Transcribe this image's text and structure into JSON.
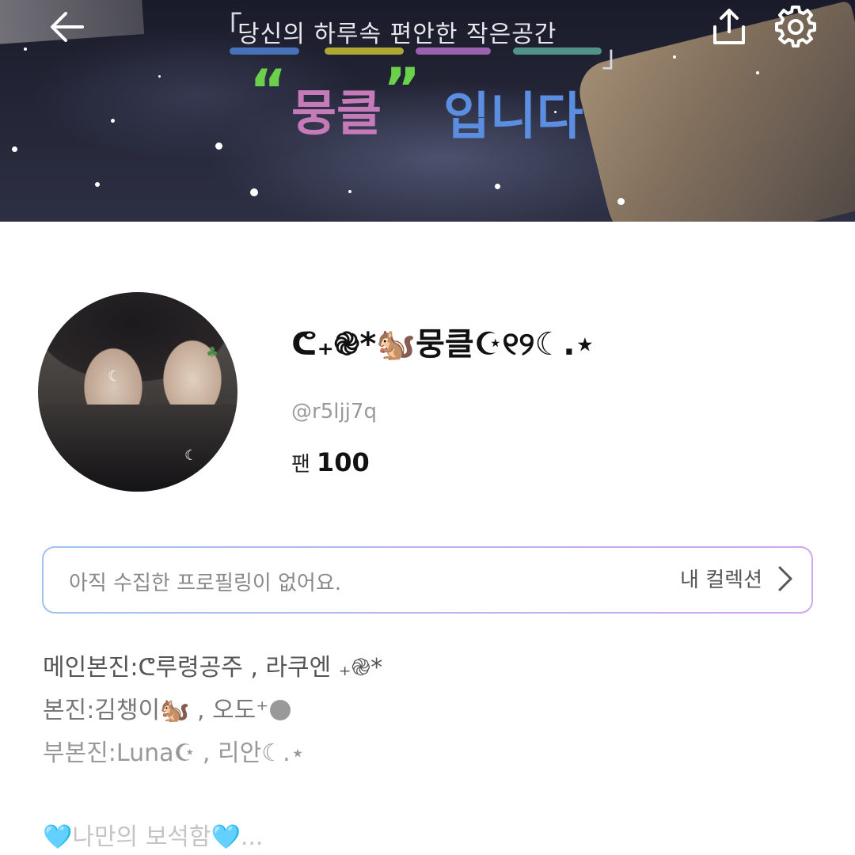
{
  "banner": {
    "subtitle": "당신의 하루속 편안한 작은공간",
    "open_quote": "“",
    "close_quote": "”",
    "main": "뭉클",
    "suffix": "입니다"
  },
  "toolbar": {
    "back_icon": "arrow-left-icon",
    "share_icon": "share-icon",
    "settings_icon": "gear-icon"
  },
  "profile": {
    "name": "ᕦ₊֎*🐿️뭉클☪︎୧୨☾.⋆",
    "handle": "@r5ljj7q",
    "fans_label": "팬",
    "fans_count": "100"
  },
  "collection": {
    "empty_text": "아직 수집한 프로필링이 없어요.",
    "link_label": "내 컬렉션"
  },
  "bio": {
    "line1": "메인본진:ᕦ루령공주 , 라쿠엔 ₊֎*",
    "line2_text": "본진:김챙이🐿️ , 오도⁺",
    "line3": "부본진:Luna☪︎ , 리안☾.⋆",
    "line4_text": "나만의 보석함",
    "line4_heart": "🩵",
    "line4_tail": "..."
  },
  "colors": {
    "accent_gradient_start": "#9ec3ef",
    "accent_gradient_end": "#d0a6ee",
    "banner_green": "#6bd14a",
    "banner_pink": "#c77ab9",
    "banner_blue": "#5b8ee0"
  }
}
